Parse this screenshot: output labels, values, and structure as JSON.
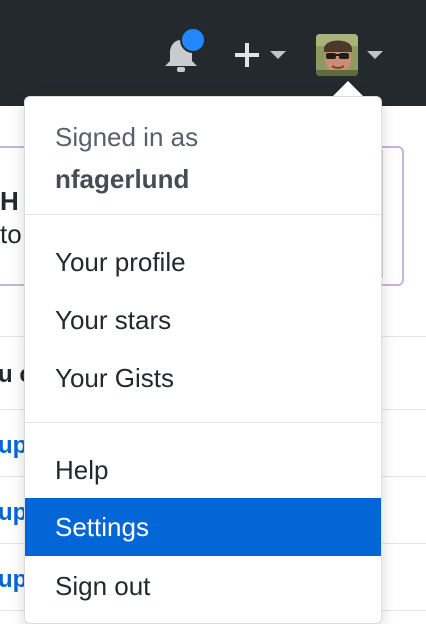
{
  "header": {
    "notifications": {
      "icon": "bell-icon",
      "has_unread": true,
      "dot_color": "#2188ff"
    },
    "create_menu": {
      "icon": "plus-icon"
    },
    "user_menu": {
      "icon": "avatar"
    }
  },
  "background": {
    "card_heading_fragment": "H",
    "card_text_fragment": "to",
    "list_header_fragment": "u c",
    "list_link_fragments": [
      "up",
      "up",
      "up"
    ]
  },
  "dropdown": {
    "signed_in_label": "Signed in as",
    "username": "nfagerlund",
    "sections": [
      {
        "items": [
          {
            "label": "Your profile"
          },
          {
            "label": "Your stars"
          },
          {
            "label": "Your Gists"
          }
        ]
      },
      {
        "items": [
          {
            "label": "Help"
          },
          {
            "label": "Settings",
            "active": true
          },
          {
            "label": "Sign out"
          }
        ]
      }
    ],
    "active_color": "#0366d6"
  }
}
